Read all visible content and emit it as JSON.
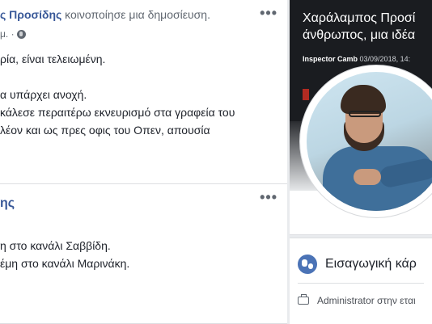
{
  "post1": {
    "author": "ς Προσίδης",
    "action": " κοινοποίησε μια δημοσίευση.",
    "meta": "μ. · ",
    "more": "•••",
    "lines": [
      "ρία, είναι τελειωμένη.",
      "",
      "α υπάρχει ανοχή.",
      "κάλεσε περαιτέρω εκνευρισμό στα γραφεία του",
      "λέον και ως πρες οφις του Οπεν, απουσία"
    ]
  },
  "post2": {
    "name": "ης",
    "more": "•••",
    "lines": [
      "η στο κανάλι Σαββίδη.",
      "έμη στο κανάλι Μαρινάκη."
    ]
  },
  "sidebar": {
    "cover_title_1": "Χαράλαμπος Προσί",
    "cover_title_2": "άνθρωπος, μια ιδέα",
    "cover_author": "Inspector Camb",
    "cover_date": "03/09/2018, 14:",
    "intro_label": "Εισαγωγική κάρ",
    "admin_text": "Administrator στην εται"
  },
  "colors": {
    "link": "#385898",
    "intro_icon": "#4b73b6",
    "cover_bg": "#1a1c20"
  }
}
